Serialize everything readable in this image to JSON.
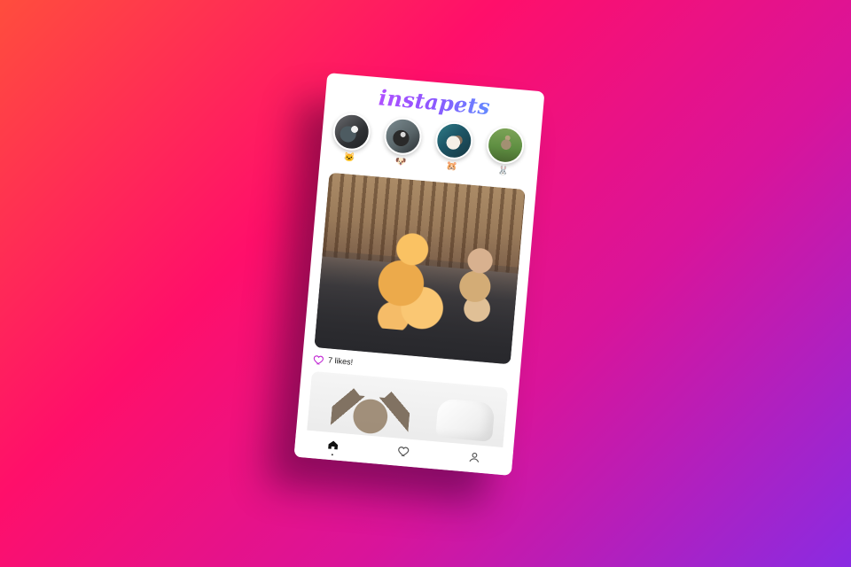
{
  "app": {
    "name": "instapets"
  },
  "colors": {
    "background_start": "#ff4d3d",
    "background_mid": "#ff0f6a",
    "background_end": "#8a2be2",
    "heart_accent": "#c026d3",
    "nav_icon": "#555555"
  },
  "stories": [
    {
      "name": "cat-story",
      "badge_icon": "cat-badge-icon",
      "emoji": "🐱"
    },
    {
      "name": "dog-story",
      "badge_icon": "dog-badge-icon",
      "emoji": "🐶"
    },
    {
      "name": "hamster-story",
      "badge_icon": "hamster-badge-icon",
      "emoji": "🐹"
    },
    {
      "name": "rabbit-story",
      "badge_icon": "rabbit-badge-icon",
      "emoji": "🐰"
    }
  ],
  "feed": {
    "posts": [
      {
        "subject": "dogs",
        "likes_text": "7 likes!"
      },
      {
        "subject": "cat"
      }
    ]
  },
  "bottom_nav": {
    "items": [
      {
        "name": "home",
        "icon": "home-icon"
      },
      {
        "name": "likes",
        "icon": "heart-icon"
      },
      {
        "name": "profile",
        "icon": "profile-icon"
      }
    ]
  }
}
